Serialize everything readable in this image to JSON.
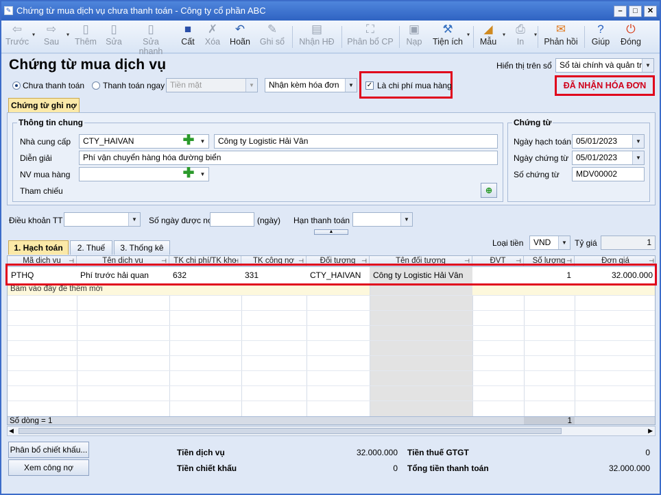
{
  "window": {
    "title": "Chứng từ mua dịch vụ chưa thanh toán - Công ty cổ phần ABC"
  },
  "toolbar": {
    "prev": "Trước",
    "next": "Sau",
    "add": "Thêm",
    "edit": "Sửa",
    "quick_edit": "Sửa nhanh",
    "save": "Cất",
    "delete": "Xóa",
    "undo": "Hoãn",
    "post": "Ghi sổ",
    "receive_invoice": "Nhận HĐ",
    "allocate": "Phân bổ CP",
    "load": "Nạp",
    "utilities": "Tiện ích",
    "template": "Mẫu",
    "print": "In",
    "feedback": "Phản hồi",
    "help": "Giúp",
    "close": "Đóng"
  },
  "header": {
    "page_title": "Chứng từ mua dịch vụ",
    "display_label": "Hiển thị trên sổ",
    "display_value": "Sổ tài chính và quản trị",
    "badge": "ĐÃ NHẬN HÓA ĐƠN"
  },
  "payment": {
    "unpaid": "Chưa thanh toán",
    "pay_now": "Thanh toán ngay",
    "method": "Tiền mặt",
    "invoice_mode": "Nhận kèm hóa đơn",
    "is_purchase_cost": "Là chi phí mua hàng"
  },
  "tabs": {
    "voucher": "Chứng từ ghi nợ"
  },
  "general": {
    "title": "Thông tin chung",
    "supplier_label": "Nhà cung cấp",
    "supplier_code": "CTY_HAIVAN",
    "supplier_name": "Công ty Logistic Hải Vân",
    "desc_label": "Diễn giải",
    "desc_value": "Phí vận chuyển hàng hóa đường biển",
    "buyer_label": "NV mua hàng",
    "buyer_value": "",
    "ref_label": "Tham chiếu"
  },
  "voucher": {
    "title": "Chứng từ",
    "post_date_label": "Ngày hạch toán",
    "post_date": "05/01/2023",
    "doc_date_label": "Ngày chứng từ",
    "doc_date": "05/01/2023",
    "doc_no_label": "Số chứng từ",
    "doc_no": "MDV00002"
  },
  "terms": {
    "payment_terms_label": "Điều khoản TT",
    "credit_days_label": "Số ngày được nợ",
    "days_unit": "(ngày)",
    "due_date_label": "Hạn thanh toán"
  },
  "detail_tabs": [
    "1. Hạch toán",
    "2. Thuế",
    "3. Thống kê"
  ],
  "currency": {
    "label": "Loại tiền",
    "value": "VND",
    "rate_label": "Tỷ giá",
    "rate_value": "1"
  },
  "grid": {
    "columns": [
      "Mã dịch vụ",
      "Tên dịch vụ",
      "TK chi phí/TK kho",
      "TK công nợ",
      "Đối tượng",
      "Tên đối tượng",
      "ĐVT",
      "Số lượng",
      "Đơn giá"
    ],
    "row": [
      "PTHQ",
      "Phí trước hải quan",
      "632",
      "331",
      "CTY_HAIVAN",
      "Công ty Logistic Hải Vân",
      "",
      "1",
      "32.000.000"
    ],
    "add_hint": "Bấm vào đây để thêm mới",
    "footer_count": "Số dòng = 1",
    "footer_qty": "1"
  },
  "bottom": {
    "allocate_discount": "Phân bổ chiết khấu...",
    "view_debt": "Xem công nợ",
    "service_amount_label": "Tiền dịch vụ",
    "service_amount": "32.000.000",
    "discount_label": "Tiền chiết khấu",
    "discount": "0",
    "vat_label": "Tiền thuế GTGT",
    "vat": "0",
    "total_label": "Tổng tiền thanh toán",
    "total": "32.000.000"
  }
}
